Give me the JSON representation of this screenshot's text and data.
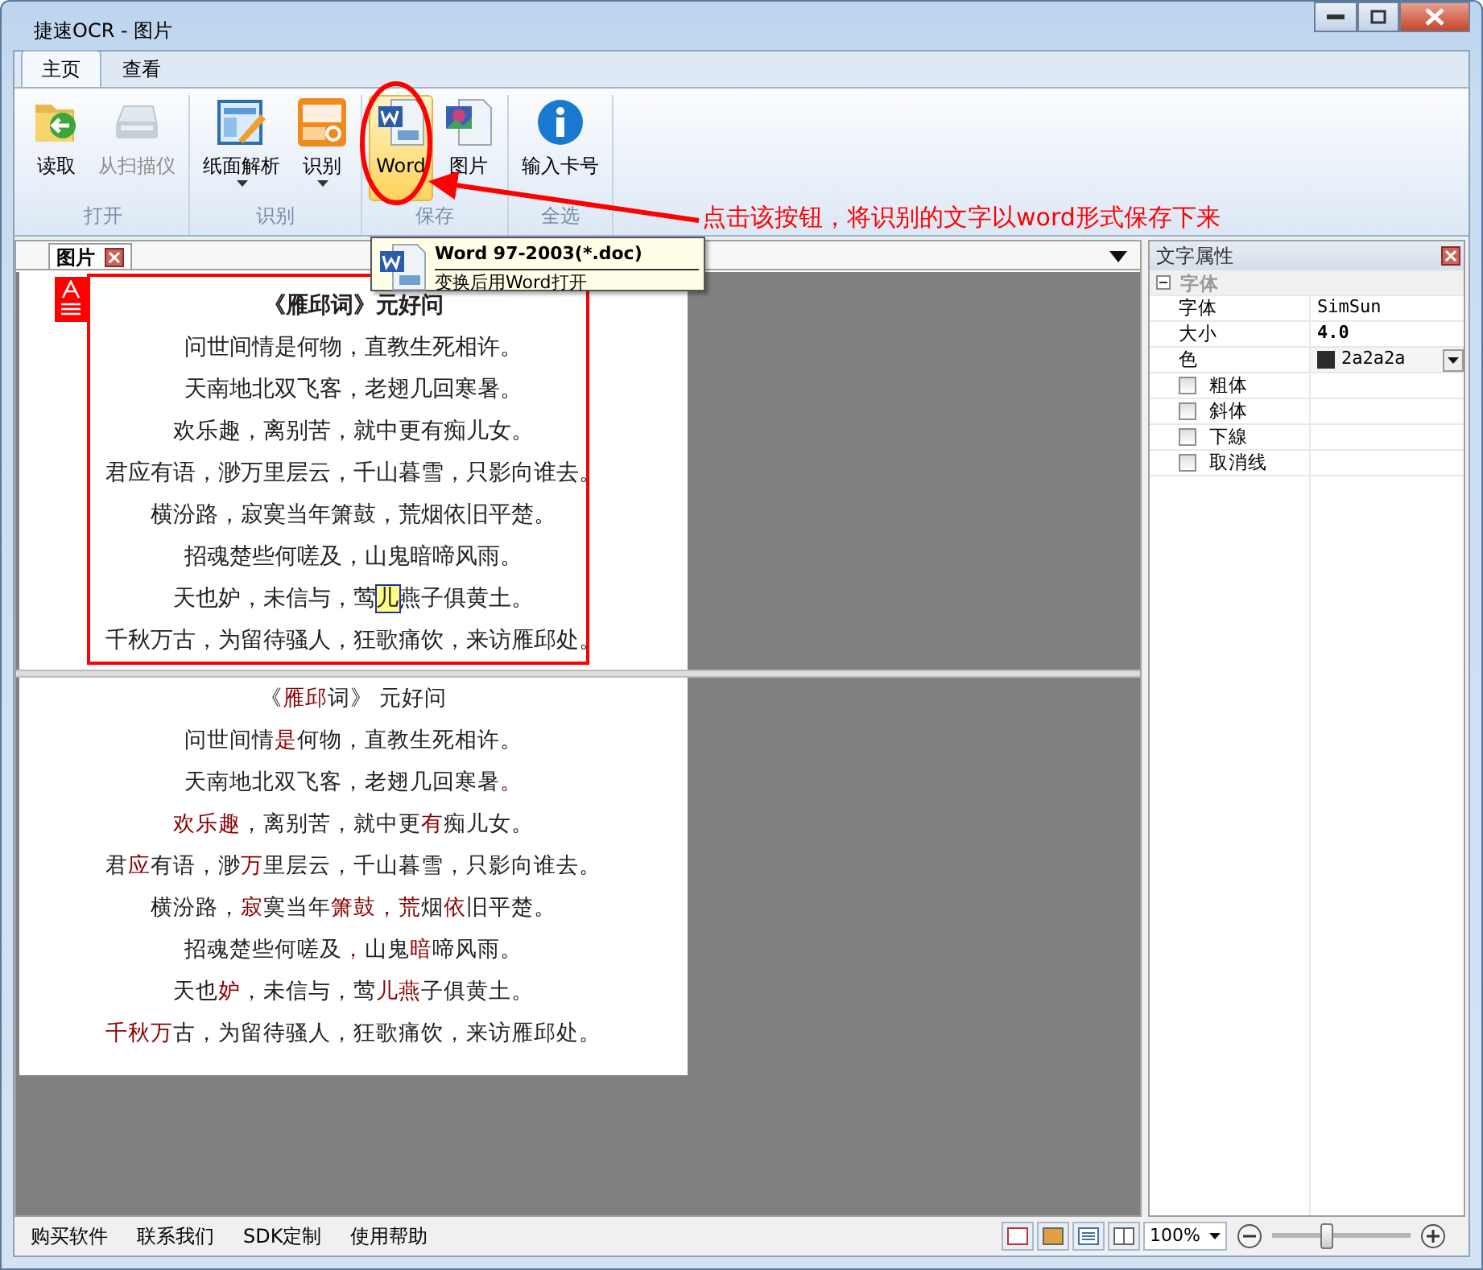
{
  "window": {
    "title": "捷速OCR - 图片"
  },
  "ribbon_tabs": [
    {
      "label": "主页",
      "selected": true
    },
    {
      "label": "查看",
      "selected": false
    }
  ],
  "ribbon_groups": [
    {
      "label": "打开",
      "buttons": [
        {
          "label": "读取",
          "kind": "folder",
          "disabled": false,
          "dropdown": false,
          "highlighted": false
        },
        {
          "label": "从扫描仪",
          "kind": "scanner",
          "disabled": true,
          "dropdown": false,
          "highlighted": false
        }
      ]
    },
    {
      "label": "识别",
      "buttons": [
        {
          "label": "纸面解析",
          "kind": "layout",
          "disabled": false,
          "dropdown": true,
          "highlighted": false
        },
        {
          "label": "识别",
          "kind": "ocr",
          "disabled": false,
          "dropdown": true,
          "highlighted": false
        }
      ]
    },
    {
      "label": "保存",
      "buttons": [
        {
          "label": "Word",
          "kind": "word",
          "disabled": false,
          "dropdown": false,
          "highlighted": true
        },
        {
          "label": "图片",
          "kind": "image",
          "disabled": false,
          "dropdown": false,
          "highlighted": false
        }
      ]
    },
    {
      "label": "全选",
      "buttons": [
        {
          "label": "输入卡号",
          "kind": "info",
          "disabled": false,
          "dropdown": false,
          "highlighted": false
        }
      ]
    }
  ],
  "annotation": {
    "text": "点击该按钮，将识别的文字以word形式保存下来"
  },
  "tooltip": {
    "title": "Word 97-2003(*.doc)",
    "description": "变换后用Word打开"
  },
  "doc_tab": {
    "label": "图片"
  },
  "scan_lines": [
    [
      {
        "text": "《雁邱词》元好问",
        "selected": false
      }
    ],
    [
      {
        "text": "问世间情是何物，直教生死相许。",
        "selected": false
      }
    ],
    [
      {
        "text": "天南地北双飞客，老翅几回寒暑。",
        "selected": false
      }
    ],
    [
      {
        "text": "欢乐趣，离别苦，就中更有痴儿女。",
        "selected": false
      }
    ],
    [
      {
        "text": "君应有语，渺万里层云，千山暮雪，只影向谁去。",
        "selected": false
      }
    ],
    [
      {
        "text": "横汾路，寂寞当年箫鼓，荒烟依旧平楚。",
        "selected": false
      }
    ],
    [
      {
        "text": "招魂楚些何嗟及，山鬼暗啼风雨。",
        "selected": false
      }
    ],
    [
      {
        "text": "天也妒，未信与，莺",
        "selected": false
      },
      {
        "text": "儿",
        "selected": true
      },
      {
        "text": "燕子俱黄土。",
        "selected": false
      }
    ],
    [
      {
        "text": "千秋万古，为留待骚人，狂歌痛饮，来访雁邱处。",
        "selected": false
      }
    ]
  ],
  "text_lines": [
    [
      {
        "text": "《",
        "flagged": false
      },
      {
        "text": "雁邱",
        "flagged": true
      },
      {
        "text": "词》 元好问",
        "flagged": false
      }
    ],
    [
      {
        "text": "问世间情",
        "flagged": false
      },
      {
        "text": "是",
        "flagged": true
      },
      {
        "text": "何物，直教生死相许。",
        "flagged": false
      }
    ],
    [
      {
        "text": "天南地北双飞客，老翅几回寒暑",
        "flagged": false
      },
      {
        "text": "。",
        "flagged": true
      }
    ],
    [
      {
        "text": "欢乐趣",
        "flagged": true
      },
      {
        "text": "，离别苦，就中更",
        "flagged": false
      },
      {
        "text": "有",
        "flagged": true
      },
      {
        "text": "痴儿女。",
        "flagged": false
      }
    ],
    [
      {
        "text": "君",
        "flagged": false
      },
      {
        "text": "应",
        "flagged": true
      },
      {
        "text": "有语，渺",
        "flagged": false
      },
      {
        "text": "万",
        "flagged": true
      },
      {
        "text": "里层云，千山暮雪，只影向谁去。",
        "flagged": false
      }
    ],
    [
      {
        "text": "横汾路，",
        "flagged": false
      },
      {
        "text": "寂",
        "flagged": true
      },
      {
        "text": "寞当年",
        "flagged": false
      },
      {
        "text": "箫鼓，荒",
        "flagged": true
      },
      {
        "text": "烟",
        "flagged": false
      },
      {
        "text": "依",
        "flagged": true
      },
      {
        "text": "旧平楚。",
        "flagged": false
      }
    ],
    [
      {
        "text": "招魂楚些何嗟及",
        "flagged": false
      },
      {
        "text": "，",
        "flagged": true
      },
      {
        "text": "山鬼",
        "flagged": false
      },
      {
        "text": "暗",
        "flagged": true
      },
      {
        "text": "啼风雨。",
        "flagged": false
      }
    ],
    [
      {
        "text": "天也",
        "flagged": false
      },
      {
        "text": "妒",
        "flagged": true
      },
      {
        "text": "，未信与，莺",
        "flagged": false
      },
      {
        "text": "儿燕",
        "flagged": true
      },
      {
        "text": "子俱黄土。",
        "flagged": false
      }
    ],
    [
      {
        "text": "千秋万",
        "flagged": true
      },
      {
        "text": "古，为留待骚人，狂歌痛饮，来访雁邱处。",
        "flagged": false
      }
    ]
  ],
  "properties": {
    "title": "文字属性",
    "category": {
      "label": "字体",
      "expanded": true
    },
    "rows": [
      {
        "kind": "text",
        "name": "字体",
        "value": "SimSun",
        "bold": false
      },
      {
        "kind": "text",
        "name": "大小",
        "value": "4.0",
        "bold": true
      },
      {
        "kind": "color",
        "name": "色",
        "value": "2a2a2a",
        "color": "#2a2a2a"
      },
      {
        "kind": "check",
        "name": "粗体",
        "checked": false
      },
      {
        "kind": "check",
        "name": "斜体",
        "checked": false
      },
      {
        "kind": "check",
        "name": "下線",
        "checked": false
      },
      {
        "kind": "check",
        "name": "取消线",
        "checked": false
      }
    ]
  },
  "status_bar": {
    "links": [
      "购买软件",
      "联系我们",
      "SDK定制",
      "使用帮助"
    ],
    "views": [
      {
        "kind": "fit"
      },
      {
        "kind": "image"
      },
      {
        "kind": "text"
      },
      {
        "kind": "split"
      }
    ],
    "zoom": "100%",
    "zoom_slider": {
      "level": 0.4
    }
  }
}
